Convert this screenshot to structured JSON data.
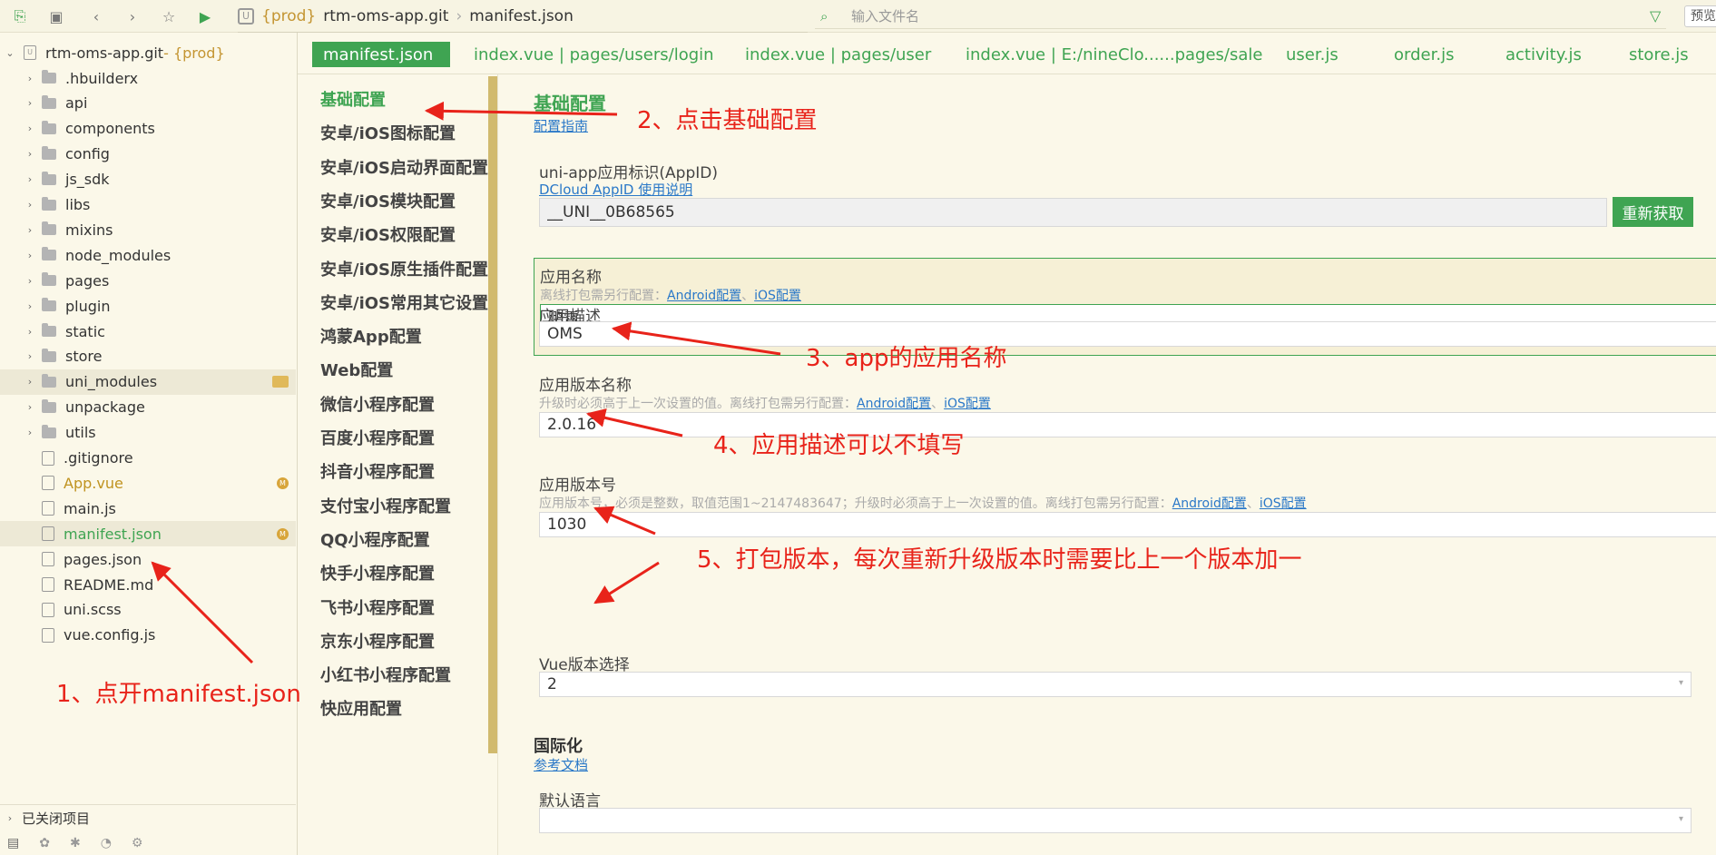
{
  "toolbar": {
    "breadcrumb": {
      "prod": "{prod}",
      "project": "rtm-oms-app.git",
      "file": "manifest.json"
    },
    "search_placeholder": "输入文件名",
    "preview_label": "预览"
  },
  "sidebar": {
    "root": {
      "name": "rtm-oms-app.git",
      "tag": " - {prod}"
    },
    "items": [
      {
        "label": ".hbuilderx"
      },
      {
        "label": "api"
      },
      {
        "label": "components"
      },
      {
        "label": "config"
      },
      {
        "label": "js_sdk"
      },
      {
        "label": "libs"
      },
      {
        "label": "mixins"
      },
      {
        "label": "node_modules"
      },
      {
        "label": "pages"
      },
      {
        "label": "plugin"
      },
      {
        "label": "static"
      },
      {
        "label": "store"
      },
      {
        "label": "uni_modules"
      },
      {
        "label": "unpackage"
      },
      {
        "label": "utils"
      },
      {
        "label": ".gitignore"
      },
      {
        "label": "App.vue",
        "badge": "M"
      },
      {
        "label": "main.js"
      },
      {
        "label": "manifest.json",
        "badge": "M"
      },
      {
        "label": "pages.json"
      },
      {
        "label": "README.md"
      },
      {
        "label": "uni.scss"
      },
      {
        "label": "vue.config.js"
      }
    ],
    "closed_projects": "已关闭项目"
  },
  "tabs": [
    {
      "label": "manifest.json"
    },
    {
      "label": "index.vue | pages/users/login"
    },
    {
      "label": "index.vue | pages/user"
    },
    {
      "label": "index.vue | E:/nineClo......pages/sale"
    },
    {
      "label": "user.js"
    },
    {
      "label": "order.js"
    },
    {
      "label": "activity.js"
    },
    {
      "label": "store.js"
    }
  ],
  "settings_nav": [
    {
      "label": "基础配置"
    },
    {
      "label": "安卓/iOS图标配置"
    },
    {
      "label": "安卓/iOS启动界面配置"
    },
    {
      "label": "安卓/iOS模块配置"
    },
    {
      "label": "安卓/iOS权限配置"
    },
    {
      "label": "安卓/iOS原生插件配置"
    },
    {
      "label": "安卓/iOS常用其它设置"
    },
    {
      "label": "鸿蒙App配置"
    },
    {
      "label": "Web配置"
    },
    {
      "label": "微信小程序配置"
    },
    {
      "label": "百度小程序配置"
    },
    {
      "label": "抖音小程序配置"
    },
    {
      "label": "支付宝小程序配置"
    },
    {
      "label": "QQ小程序配置"
    },
    {
      "label": "快手小程序配置"
    },
    {
      "label": "飞书小程序配置"
    },
    {
      "label": "京东小程序配置"
    },
    {
      "label": "小红书小程序配置"
    },
    {
      "label": "快应用配置"
    }
  ],
  "form": {
    "section_title": "基础配置",
    "guide_link": "配置指南",
    "appid": {
      "label": "uni-app应用标识(AppID)",
      "link": "DCloud AppID 使用说明",
      "value": "__UNI__0B68565",
      "button": "重新获取"
    },
    "app_name": {
      "label": "应用名称",
      "hint": "离线打包需另行配置：",
      "android": "Android配置",
      "sep": "、",
      "ios": "iOS配置",
      "value": "鹏霄"
    },
    "app_desc": {
      "label": "应用描述",
      "value": "OMS"
    },
    "version_name": {
      "label": "应用版本名称",
      "hint": "升级时必须高于上一次设置的值。离线打包需另行配置：",
      "android": "Android配置",
      "sep": "、",
      "ios": "iOS配置",
      "value": "2.0.16"
    },
    "version_code": {
      "label": "应用版本号",
      "hint": "应用版本号，必须是整数，取值范围1~2147483647；升级时必须高于上一次设置的值。离线打包需另行配置：",
      "android": "Android配置",
      "sep": "、",
      "ios": "iOS配置",
      "value": "1030"
    },
    "vue_version": {
      "label": "Vue版本选择",
      "value": "2"
    },
    "i18n": {
      "title": "国际化",
      "link": "参考文档",
      "default_lang_label": "默认语言",
      "default_lang_value": ""
    }
  },
  "annotations": {
    "step1": "1、点开manifest.json",
    "step2": "2、点击基础配置",
    "step3": "3、app的应用名称",
    "step4": "4、应用描述可以不填写",
    "step5": "5、打包版本，每次重新升级版本时需要比上一个版本加一"
  },
  "colors": {
    "accent": "#3fa452",
    "annotation": "#e8231a",
    "link": "#2a78c8",
    "background": "#fbf8e9"
  }
}
